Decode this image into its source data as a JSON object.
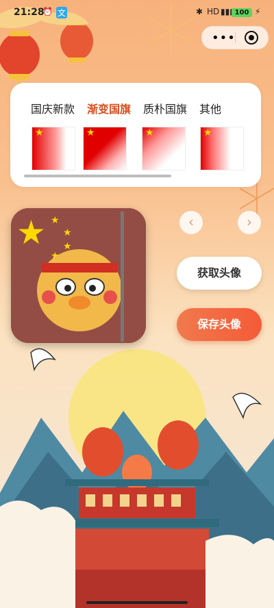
{
  "status_bar": {
    "time": "21:28",
    "battery": "100"
  },
  "tabs": [
    {
      "label": "国庆新款",
      "active": false
    },
    {
      "label": "渐变国旗",
      "active": true
    },
    {
      "label": "质朴国旗",
      "active": false
    },
    {
      "label": "其他",
      "active": false
    }
  ],
  "buttons": {
    "get_avatar": "获取头像",
    "save_avatar": "保存头像"
  },
  "colors": {
    "accent": "#d94f1f",
    "flag_red": "#e10000",
    "star": "#ffd800",
    "save_btn": "#f46440"
  }
}
